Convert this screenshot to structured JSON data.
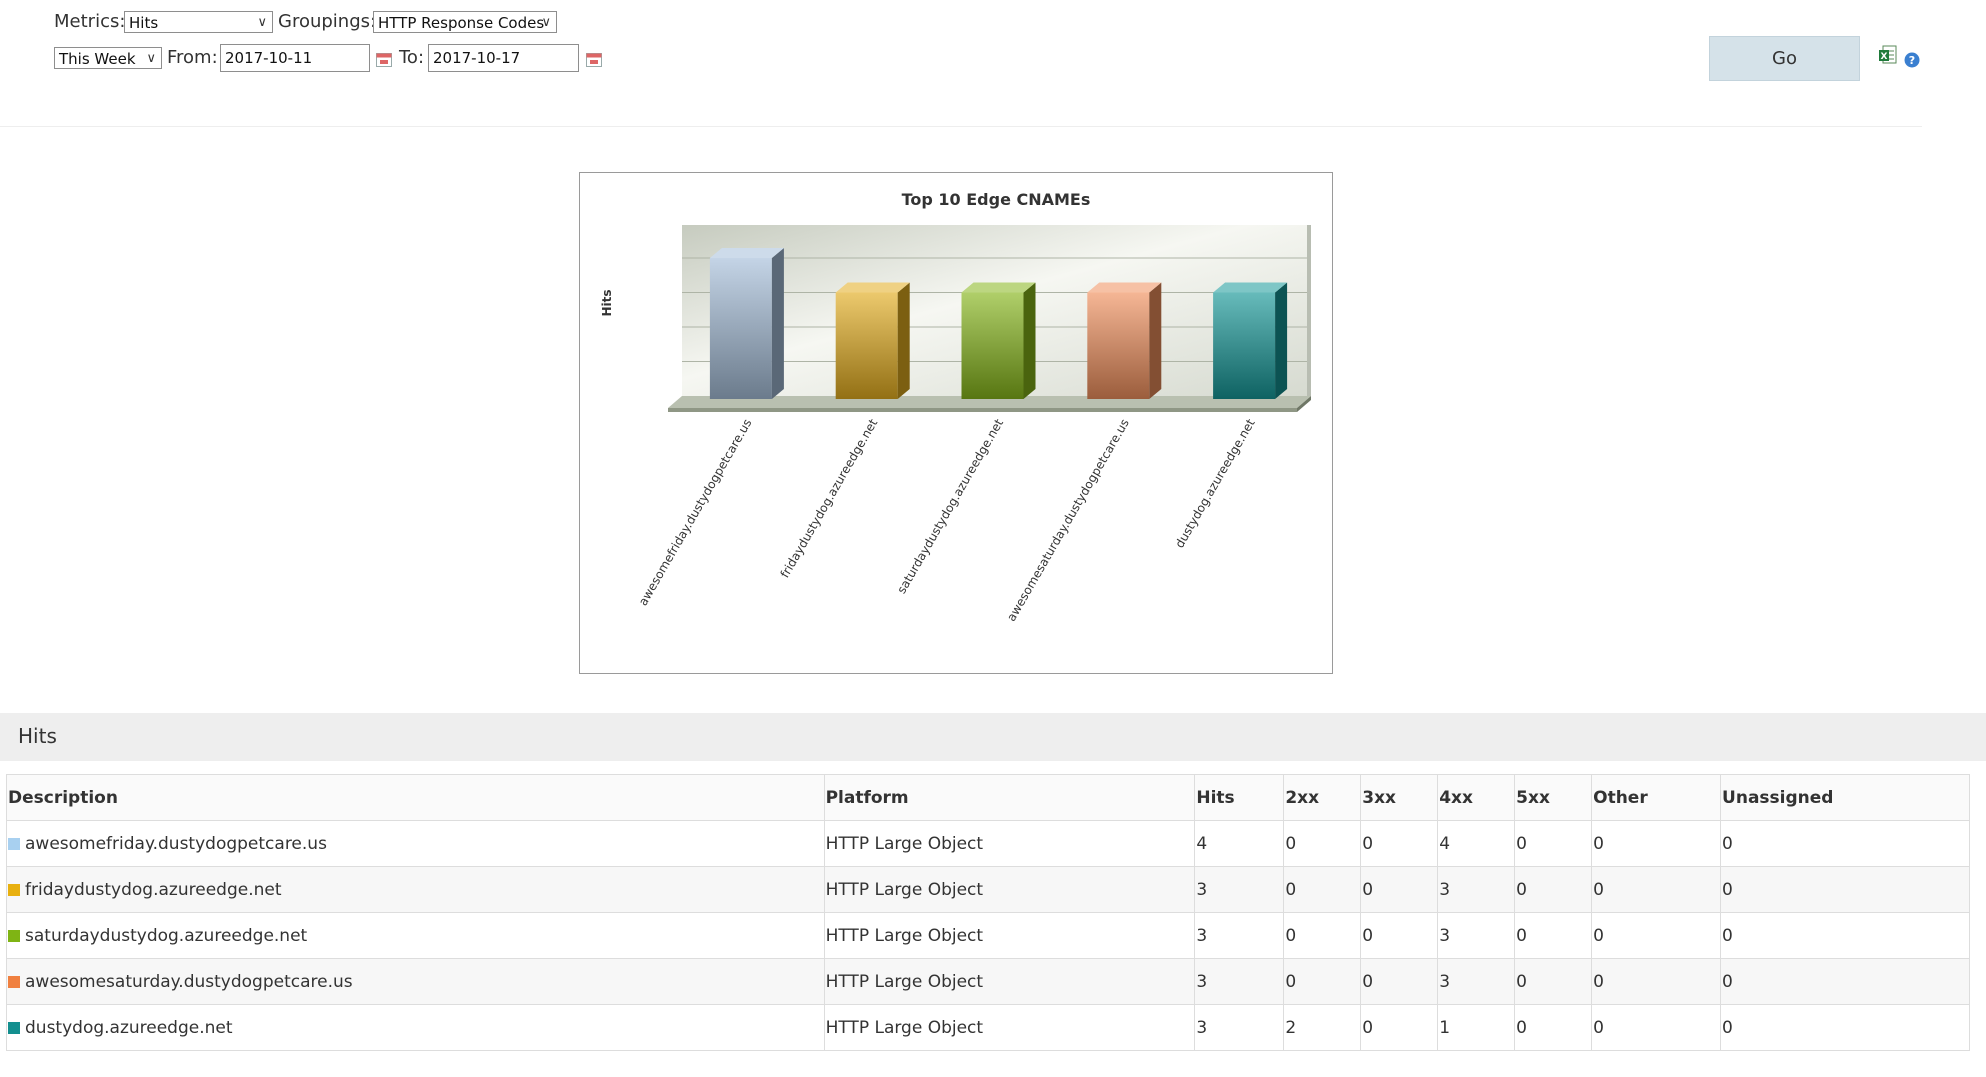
{
  "filters": {
    "metrics_label": "Metrics:",
    "metrics_value": "Hits",
    "groupings_label": "Groupings:",
    "groupings_value": "HTTP Response Codes",
    "range_value": "This Week",
    "from_label": "From:",
    "from_value": "2017-10-11",
    "to_label": "To:",
    "to_value": "2017-10-17",
    "go_label": "Go",
    "icons": [
      "calendar-icon",
      "chevron-down-icon",
      "excel-export-icon",
      "help-icon"
    ]
  },
  "chart_data": {
    "type": "bar",
    "title": "Top 10 Edge CNAMEs",
    "ylabel": "Hits",
    "xlabel": "",
    "categories": [
      "awesomefriday.dustydogpetcare.us",
      "fridaydustydog.azureedge.net",
      "saturdaydustydog.azureedge.net",
      "awesomesaturday.dustydogpetcare.us",
      "dustydog.azureedge.net"
    ],
    "values": [
      4,
      3,
      3,
      3,
      3
    ],
    "colors": [
      "#a4bdd8",
      "#e2ac1e",
      "#86b51a",
      "#ef8f5c",
      "#159797"
    ],
    "ylim": [
      0,
      4
    ],
    "grid": true,
    "style": "3d"
  },
  "section": {
    "title": "Hits"
  },
  "table": {
    "headers": [
      "Description",
      "Platform",
      "Hits",
      "2xx",
      "3xx",
      "4xx",
      "5xx",
      "Other",
      "Unassigned"
    ],
    "rows": [
      {
        "swatch": "#a8d0f0",
        "cells": [
          "awesomefriday.dustydogpetcare.us",
          "HTTP Large Object",
          "4",
          "0",
          "0",
          "4",
          "0",
          "0",
          "0"
        ]
      },
      {
        "swatch": "#e8b010",
        "cells": [
          "fridaydustydog.azureedge.net",
          "HTTP Large Object",
          "3",
          "0",
          "0",
          "3",
          "0",
          "0",
          "0"
        ]
      },
      {
        "swatch": "#7fb414",
        "cells": [
          "saturdaydustydog.azureedge.net",
          "HTTP Large Object",
          "3",
          "0",
          "0",
          "3",
          "0",
          "0",
          "0"
        ]
      },
      {
        "swatch": "#f08040",
        "cells": [
          "awesomesaturday.dustydogpetcare.us",
          "HTTP Large Object",
          "3",
          "0",
          "0",
          "3",
          "0",
          "0",
          "0"
        ]
      },
      {
        "swatch": "#138f8f",
        "cells": [
          "dustydog.azureedge.net",
          "HTTP Large Object",
          "3",
          "2",
          "0",
          "1",
          "0",
          "0",
          "0"
        ]
      }
    ]
  }
}
